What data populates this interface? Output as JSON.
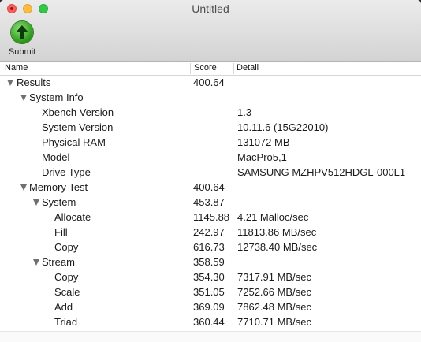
{
  "window": {
    "title": "Untitled"
  },
  "toolbar": {
    "submit_label": "Submit",
    "submit_icon": "upload-arrow-icon"
  },
  "columns": {
    "name": "Name",
    "score": "Score",
    "detail": "Detail"
  },
  "rows": [
    {
      "level": 0,
      "expanded": true,
      "name": "Results",
      "score": "400.64",
      "detail": ""
    },
    {
      "level": 1,
      "expanded": true,
      "name": "System Info",
      "score": "",
      "detail": ""
    },
    {
      "level": 2,
      "name": "Xbench Version",
      "score": "",
      "detail": "1.3"
    },
    {
      "level": 2,
      "name": "System Version",
      "score": "",
      "detail": "10.11.6 (15G22010)"
    },
    {
      "level": 2,
      "name": "Physical RAM",
      "score": "",
      "detail": "131072 MB"
    },
    {
      "level": 2,
      "name": "Model",
      "score": "",
      "detail": "MacPro5,1"
    },
    {
      "level": 2,
      "name": "Drive Type",
      "score": "",
      "detail": "SAMSUNG MZHPV512HDGL-000L1"
    },
    {
      "level": 1,
      "expanded": true,
      "name": "Memory Test",
      "score": "400.64",
      "detail": ""
    },
    {
      "level": 2,
      "expanded": true,
      "name": "System",
      "score": "453.87",
      "detail": ""
    },
    {
      "level": 3,
      "name": "Allocate",
      "score": "1145.88",
      "detail": "4.21 Malloc/sec"
    },
    {
      "level": 3,
      "name": "Fill",
      "score": "242.97",
      "detail": "11813.86 MB/sec"
    },
    {
      "level": 3,
      "name": "Copy",
      "score": "616.73",
      "detail": "12738.40 MB/sec"
    },
    {
      "level": 2,
      "expanded": true,
      "name": "Stream",
      "score": "358.59",
      "detail": ""
    },
    {
      "level": 3,
      "name": "Copy",
      "score": "354.30",
      "detail": "7317.91 MB/sec"
    },
    {
      "level": 3,
      "name": "Scale",
      "score": "351.05",
      "detail": "7252.66 MB/sec"
    },
    {
      "level": 3,
      "name": "Add",
      "score": "369.09",
      "detail": "7862.48 MB/sec"
    },
    {
      "level": 3,
      "name": "Triad",
      "score": "360.44",
      "detail": "7710.71 MB/sec"
    }
  ]
}
